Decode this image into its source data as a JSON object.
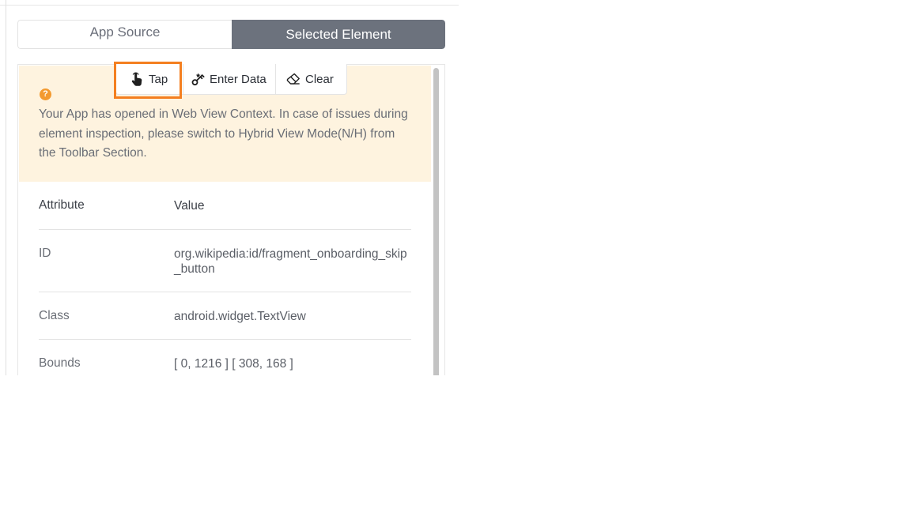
{
  "tabs": {
    "app_source": "App Source",
    "selected_element": "Selected Element"
  },
  "actions": {
    "tap": "Tap",
    "enter_data": "Enter Data",
    "clear": "Clear"
  },
  "notice": {
    "icon": "question-circle-icon",
    "icon_glyph": "?",
    "text": "Your App has opened in Web View Context. In case of issues during element inspection, please switch to Hybrid View Mode(N/H) from the Toolbar Section."
  },
  "table": {
    "header": {
      "key": "Attribute",
      "value": "Value"
    },
    "rows": [
      {
        "key": "ID",
        "value": "org.wikipedia:id/fragment_onboarding_skip_button"
      },
      {
        "key": "Class",
        "value": "android.widget.TextView"
      },
      {
        "key": "Bounds",
        "value": "[ 0, 1216 ] [ 308, 168 ]"
      }
    ]
  },
  "colors": {
    "accent_highlight": "#f47f20",
    "selected_tab_bg": "#6c727d",
    "notice_bg": "#fef3df",
    "notice_icon": "#f39a30"
  }
}
